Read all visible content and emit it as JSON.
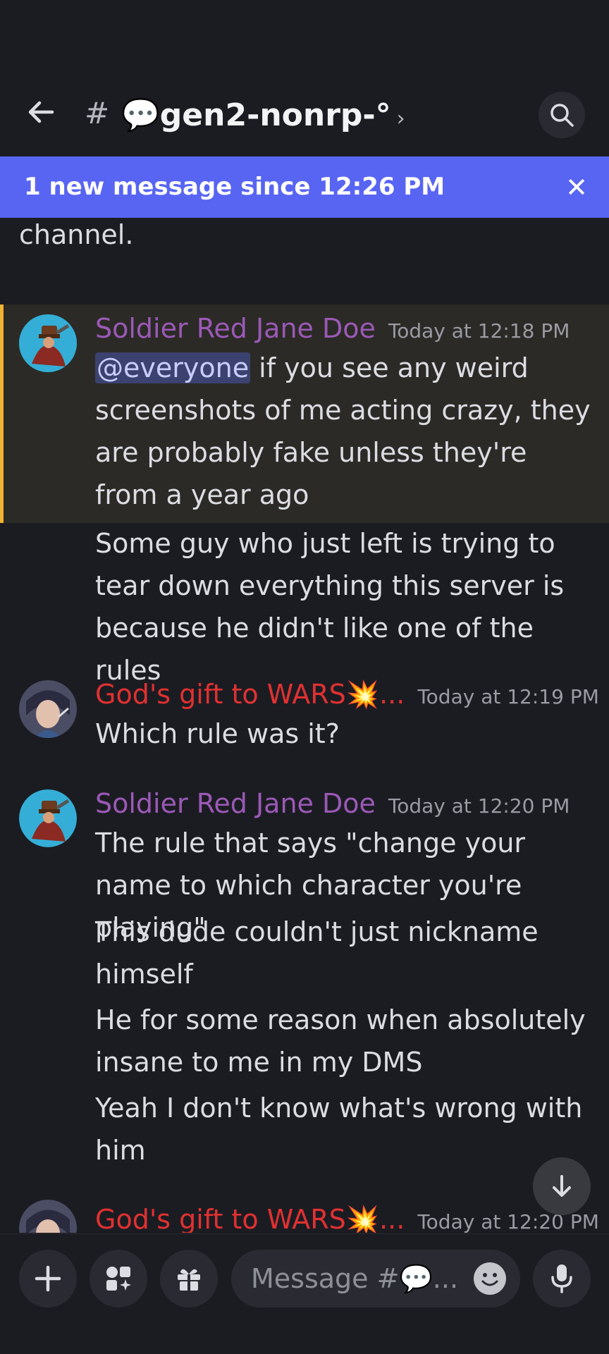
{
  "header": {
    "hash": "#",
    "channel_name": "💬gen2-nonrp-°",
    "chevron": "›"
  },
  "banner": {
    "text": "1 new message since 12:26 PM",
    "close": "✕"
  },
  "messages": {
    "cut_off_text": "channel.",
    "groups": [
      {
        "author": "Soldier Red Jane Doe",
        "timestamp": "Today at 12:18 PM",
        "mention": "@everyone",
        "lines": [
          " if you see any weird screenshots of me acting crazy, they are probably fake unless they're from a year ago",
          "Some guy who just left is trying to tear down everything this server is because he didn't like one of the rules"
        ]
      },
      {
        "author": "God's gift to WARS💥...",
        "timestamp": "Today at 12:19 PM",
        "lines": [
          "Which rule was it?"
        ]
      },
      {
        "author": "Soldier Red Jane Doe",
        "timestamp": "Today at 12:20 PM",
        "lines": [
          "The rule that says \"change your name to which character you're playing\"",
          "This dude couldn't just nickname himself",
          "He for some reason when absolutely insane to me in my DMS",
          "Yeah I don't know what's wrong with him"
        ]
      },
      {
        "author": "God's gift to WARS💥...",
        "timestamp": "Today at 12:20 PM",
        "lines": []
      }
    ]
  },
  "composer": {
    "placeholder": "Message #💬..."
  },
  "colors": {
    "background": "#1b1c22",
    "banner": "#5865f2",
    "author_soldier": "#9b59b6",
    "author_gods_gift": "#e03131",
    "highlight_border": "#f0b232"
  },
  "icons": [
    "arrow-left-icon",
    "search-icon",
    "close-icon",
    "arrow-down-icon",
    "plus-icon",
    "apps-icon",
    "gift-icon",
    "emoji-icon",
    "microphone-icon"
  ]
}
